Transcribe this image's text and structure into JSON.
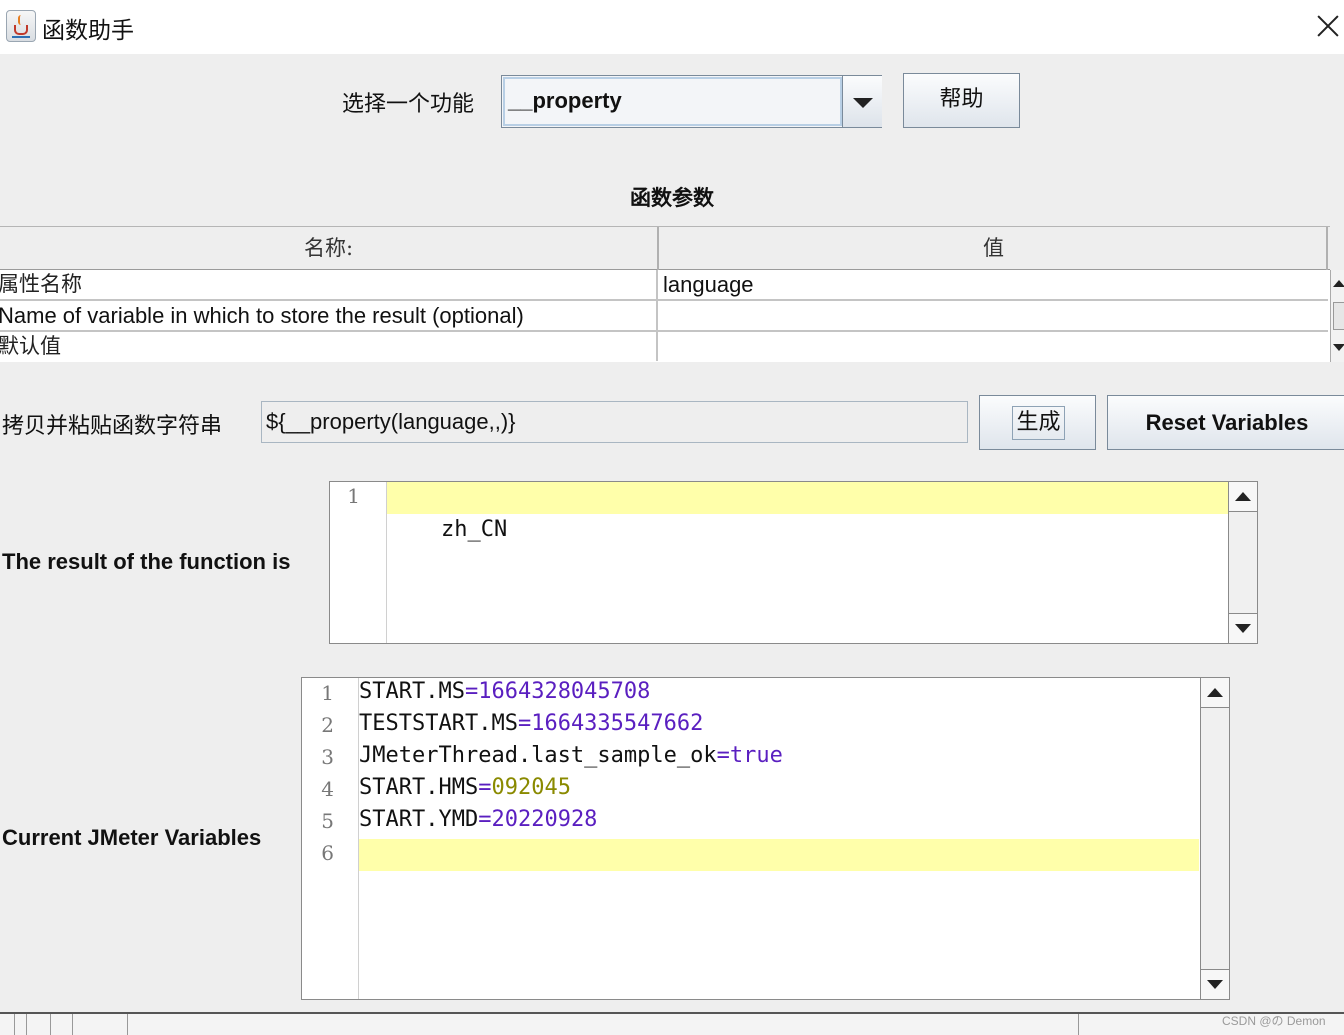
{
  "window": {
    "title": "函数助手"
  },
  "selector": {
    "label": "选择一个功能",
    "value": "__property",
    "help_label": "帮助"
  },
  "params": {
    "heading": "函数参数",
    "columns": [
      "名称:",
      "值"
    ],
    "rows": [
      {
        "name": "属性名称",
        "value": "language"
      },
      {
        "name": "Name of variable in which to store the result (optional)",
        "value": ""
      },
      {
        "name": "默认值",
        "value": ""
      }
    ]
  },
  "copy": {
    "label": "拷贝并粘贴函数字符串",
    "value": "${__property(language,,)}",
    "generate_label": "生成",
    "reset_label": "Reset Variables"
  },
  "result": {
    "label": "The result of the function is",
    "lines": [
      {
        "num": "1",
        "text": "zh_CN"
      }
    ]
  },
  "variables": {
    "label": "Current JMeter Variables",
    "lines": [
      {
        "num": "1",
        "key": "START.MS",
        "eq": "=",
        "value": "1664328045708"
      },
      {
        "num": "2",
        "key": "TESTSTART.MS",
        "eq": "=",
        "value": "1664335547662"
      },
      {
        "num": "3",
        "key": "JMeterThread.last_sample_ok",
        "eq": "=",
        "value": "true"
      },
      {
        "num": "4",
        "key": "START.HMS",
        "eq": "=",
        "value": "092045"
      },
      {
        "num": "5",
        "key": "START.YMD",
        "eq": "=",
        "value": "20220928"
      },
      {
        "num": "6",
        "key": "",
        "eq": "",
        "value": ""
      }
    ]
  },
  "watermark": "CSDN @の Demon",
  "colors": {
    "highlight_line": "#ffffaa",
    "value_purple": "#5a1fc0",
    "value_olive": "#8a8a00"
  }
}
